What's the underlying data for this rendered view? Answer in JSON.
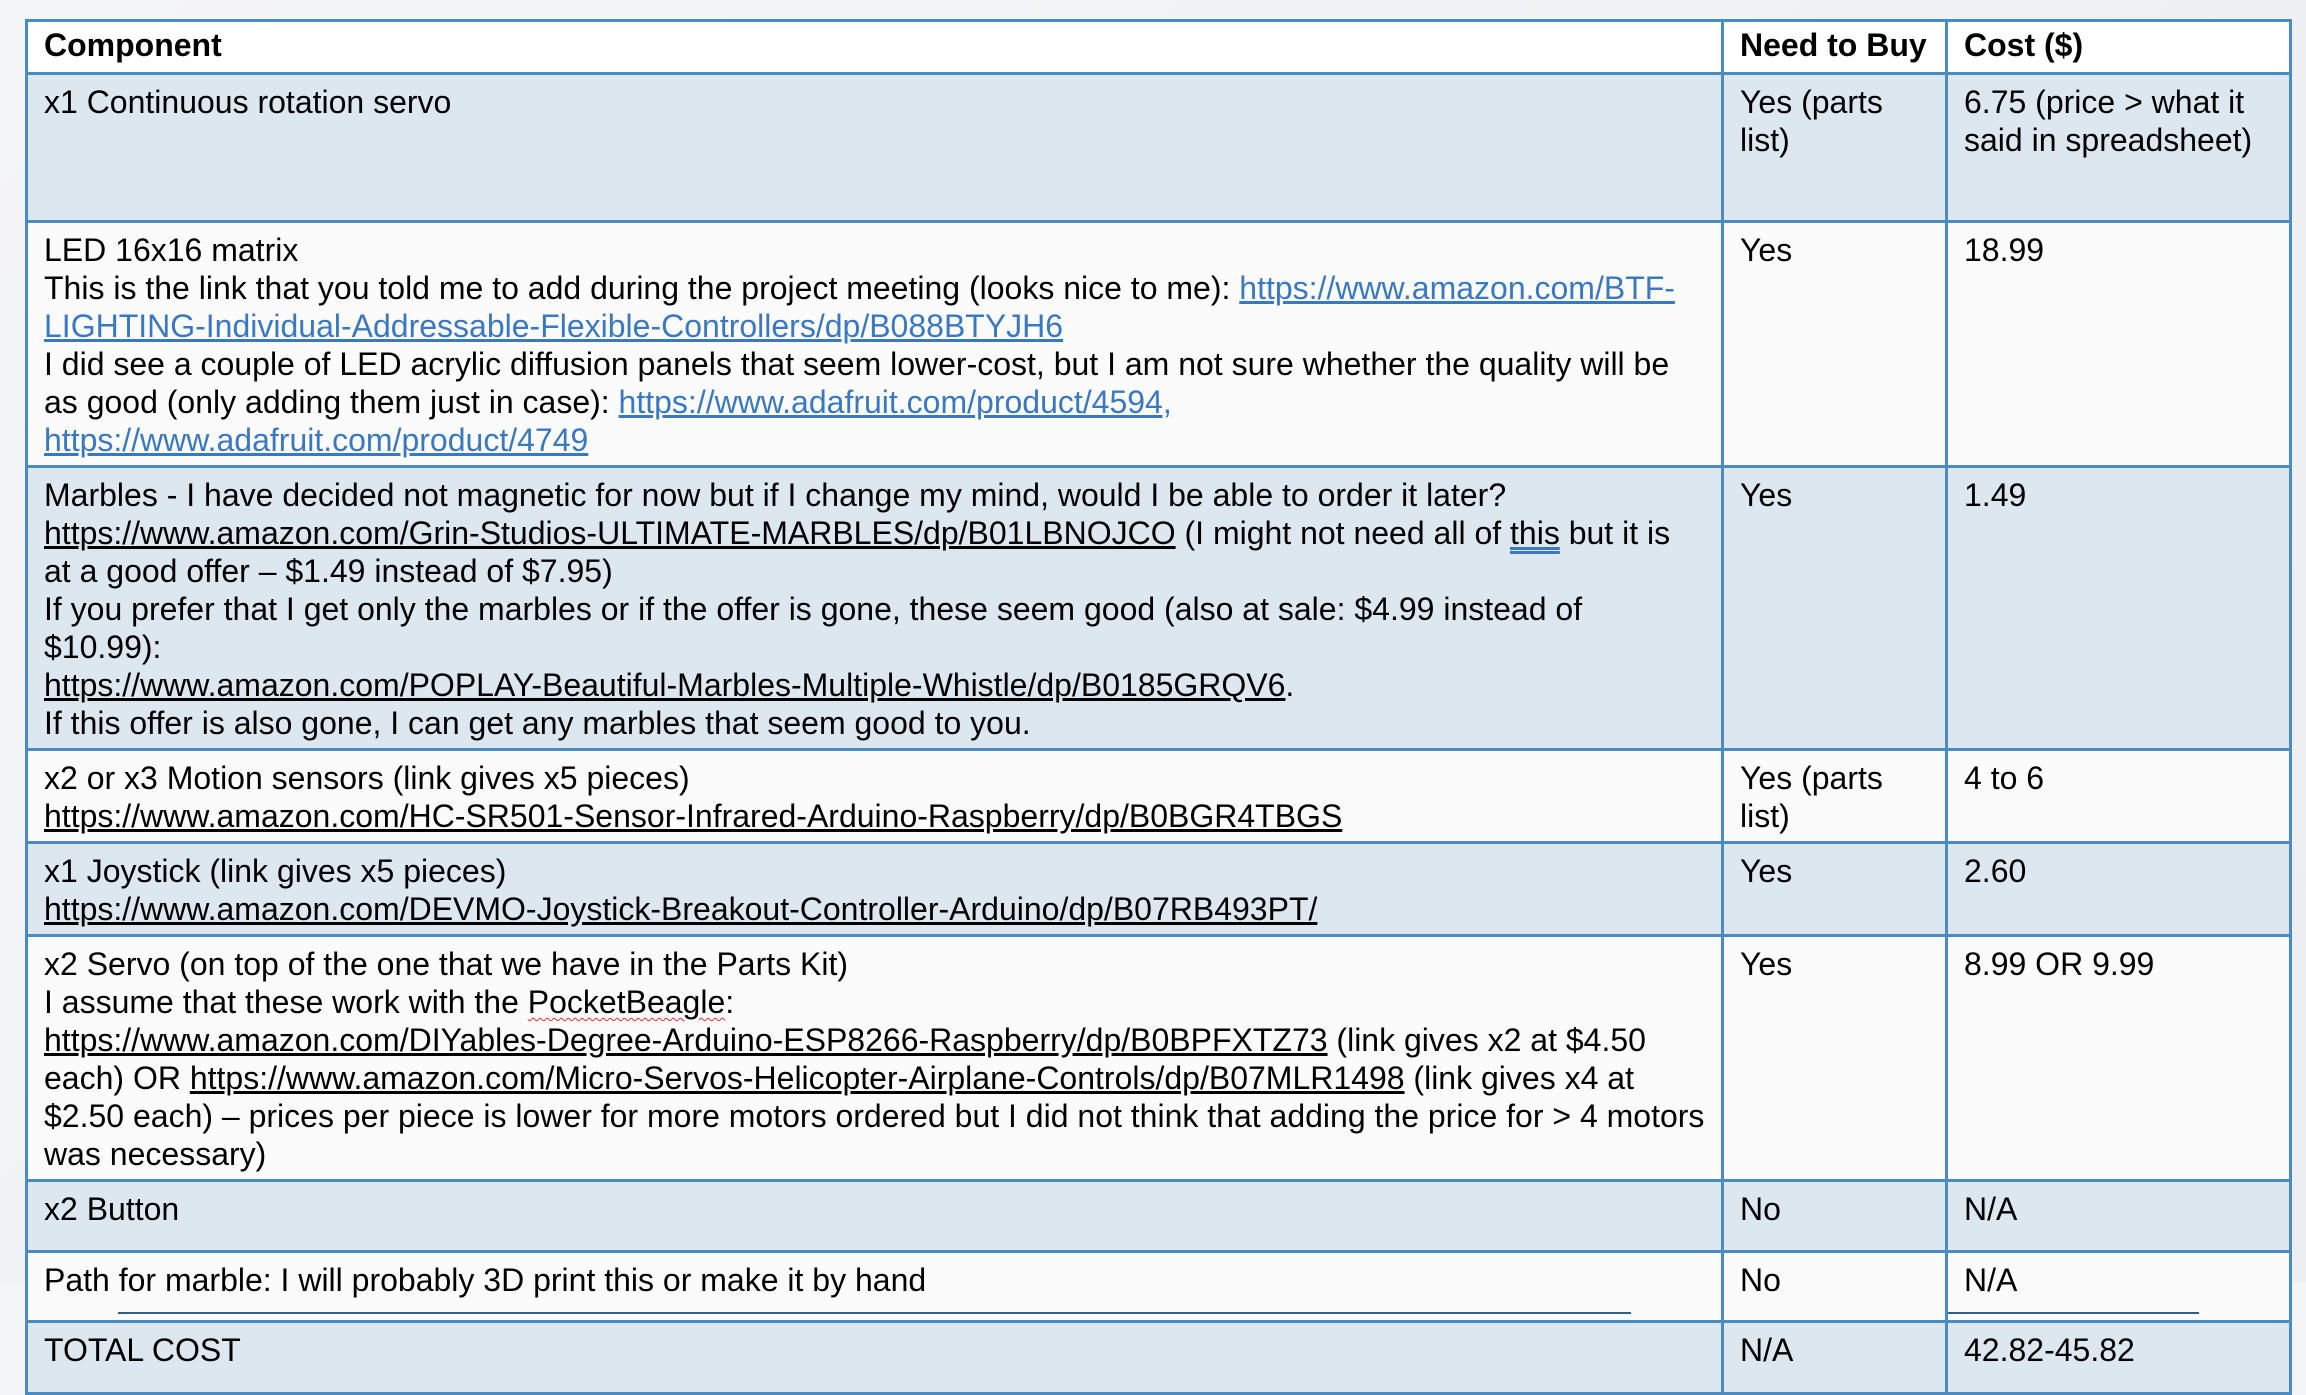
{
  "headers": {
    "component": "Component",
    "need": "Need to Buy",
    "cost": "Cost ($)"
  },
  "rows": [
    {
      "component": [
        "x1 Continuous rotation servo"
      ],
      "need": "Yes (parts list)",
      "cost": "6.75 (price > what it said in spreadsheet)"
    },
    {
      "component_title": "LED 16x16 matrix",
      "component_line2": "This is the link that you told me to add during the project meeting (looks nice to me): ",
      "link1": "https://www.amazon.com/BTF-LIGHTING-Individual-Addressable-Flexible-Controllers/dp/B088BTYJH6",
      "component_line3": "I did see a couple of LED acrylic diffusion panels that seem lower-cost, but I am not sure whether the quality will be as good (only adding them just in case): ",
      "link2": "https://www.adafruit.com/product/4594,",
      "link3": "https://www.adafruit.com/product/4749",
      "need": "Yes",
      "cost": "18.99"
    },
    {
      "line1": "Marbles - I have decided not magnetic for now but if I change my mind, would I be able to order it later?",
      "link1": "https://www.amazon.com/Grin-Studios-ULTIMATE-MARBLES/dp/B01LBNOJCO",
      "line2a": " (I might not need all of ",
      "line2b": "this",
      "line2c": " but it is at a good offer – $1.49 instead of $7.95)",
      "line3": "If you prefer that I get only the marbles or if the offer is gone, these seem good (also at sale: $4.99 instead of $10.99):",
      "link2": "https://www.amazon.com/POPLAY-Beautiful-Marbles-Multiple-Whistle/dp/B0185GRQV6",
      "link2_after": ".",
      "line4": "If this offer is also gone, I can get any marbles that seem good to you.",
      "need": "Yes",
      "cost": "1.49"
    },
    {
      "line1": "x2 or x3 Motion sensors (link gives x5 pieces)",
      "link1": "https://www.amazon.com/HC-SR501-Sensor-Infrared-Arduino-Raspberry/dp/B0BGR4TBGS",
      "need": "Yes (parts list)",
      "cost": "4 to 6"
    },
    {
      "line1": "x1 Joystick (link gives x5 pieces)",
      "link1": "https://www.amazon.com/DEVMO-Joystick-Breakout-Controller-Arduino/dp/B07RB493PT/",
      "need": "Yes",
      "cost": "2.60"
    },
    {
      "line1": "x2 Servo (on top of the one that we have in the Parts Kit)",
      "line2a": "I assume that these work with the ",
      "line2b": "PocketBeagle",
      "line2c": ":",
      "link1": "https://www.amazon.com/DIYables-Degree-Arduino-ESP8266-Raspberry/dp/B0BPFXTZ73",
      "mid": " (link gives x2 at $4.50 each) OR ",
      "link2": "https://www.amazon.com/Micro-Servos-Helicopter-Airplane-Controls/dp/B07MLR1498",
      "tail": " (link gives x4 at $2.50 each) – prices per piece is lower for more motors ordered but I did not think that adding the price for > 4 motors was necessary)",
      "need": "Yes",
      "cost": "8.99 OR 9.99"
    },
    {
      "line1": "x2 Button",
      "need": "No",
      "cost": "N/A"
    },
    {
      "line1": "Path for marble: I will probably 3D print this or make it by hand",
      "need": "No",
      "cost": "N/A"
    },
    {
      "line1": "TOTAL COST",
      "need": "N/A",
      "cost": "42.82-45.82"
    }
  ]
}
